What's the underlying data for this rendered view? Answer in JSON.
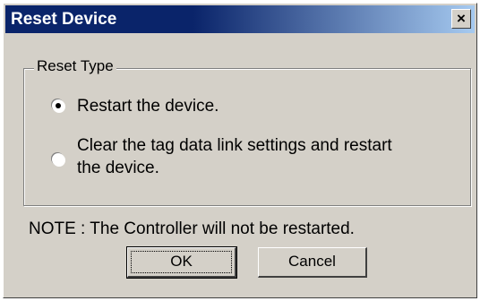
{
  "dialog": {
    "title": "Reset Device",
    "close_glyph": "×"
  },
  "reset_type": {
    "legend": "Reset Type",
    "options": [
      {
        "line1": "Restart the device.",
        "line2": "",
        "selected": true
      },
      {
        "line1": "Clear the tag data link settings and restart",
        "line2": "the device.",
        "selected": false
      }
    ]
  },
  "note": "NOTE : The Controller will not be restarted.",
  "buttons": {
    "ok_label": "OK",
    "cancel_label": "Cancel"
  }
}
